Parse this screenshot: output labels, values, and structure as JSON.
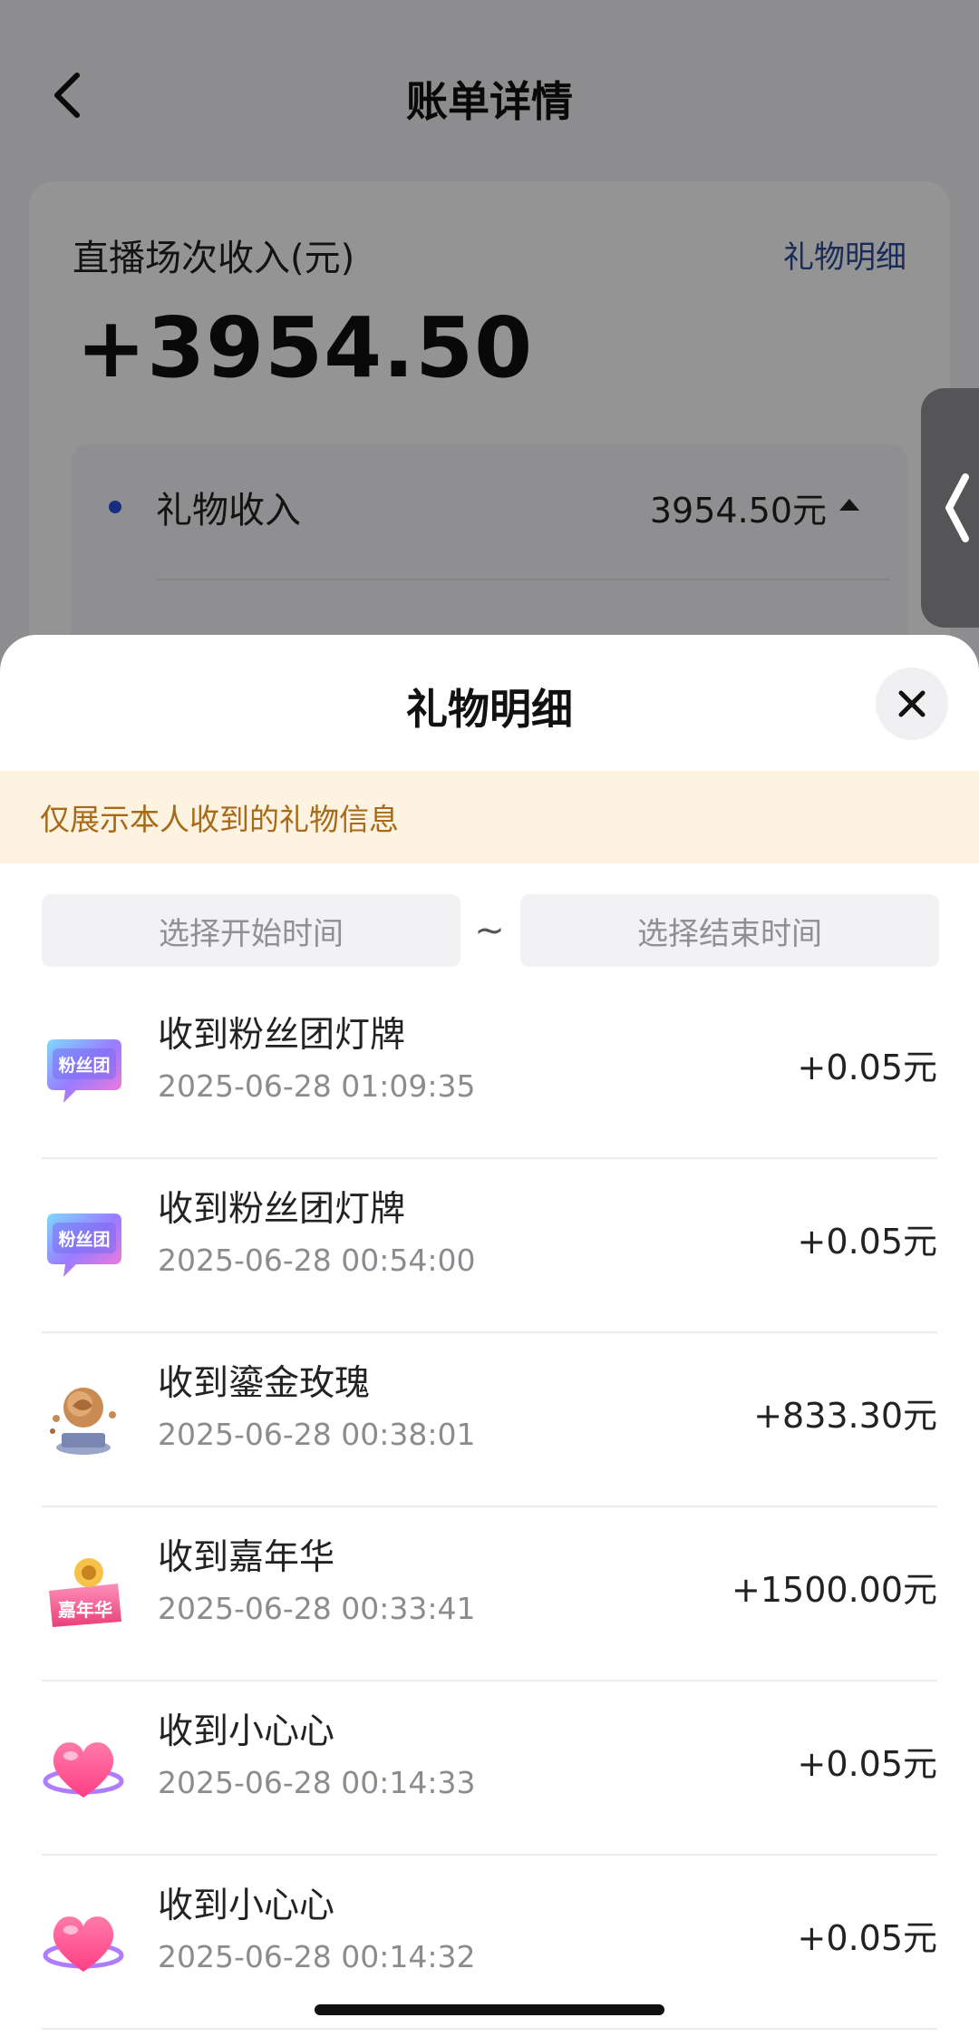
{
  "header": {
    "title": "账单详情"
  },
  "summary": {
    "label": "直播场次收入(元)",
    "link": "礼物明细",
    "amount": "+3954.50",
    "row": {
      "label": "礼物收入",
      "value": "3954.50元"
    }
  },
  "sheet": {
    "title": "礼物明细",
    "notice": "仅展示本人收到的礼物信息",
    "start_placeholder": "选择开始时间",
    "separator": "~",
    "end_placeholder": "选择结束时间",
    "items": [
      {
        "title": "收到粉丝团灯牌",
        "time": "2025-06-28 01:09:35",
        "amount": "+0.05元",
        "icon": "fan-club-badge-icon",
        "badge": "粉丝团"
      },
      {
        "title": "收到粉丝团灯牌",
        "time": "2025-06-28 00:54:00",
        "amount": "+0.05元",
        "icon": "fan-club-badge-icon",
        "badge": "粉丝团"
      },
      {
        "title": "收到鎏金玫瑰",
        "time": "2025-06-28 00:38:01",
        "amount": "+833.30元",
        "icon": "golden-rose-icon"
      },
      {
        "title": "收到嘉年华",
        "time": "2025-06-28 00:33:41",
        "amount": "+1500.00元",
        "icon": "carnival-icon",
        "badge": "嘉年华"
      },
      {
        "title": "收到小心心",
        "time": "2025-06-28 00:14:33",
        "amount": "+0.05元",
        "icon": "heart-icon"
      },
      {
        "title": "收到小心心",
        "time": "2025-06-28 00:14:32",
        "amount": "+0.05元",
        "icon": "heart-icon"
      }
    ]
  },
  "colors": {
    "link": "#2b4c9a",
    "notice_text": "#a86a18",
    "notice_bg": "#fdf3e0",
    "dot": "#2a4fe0"
  }
}
